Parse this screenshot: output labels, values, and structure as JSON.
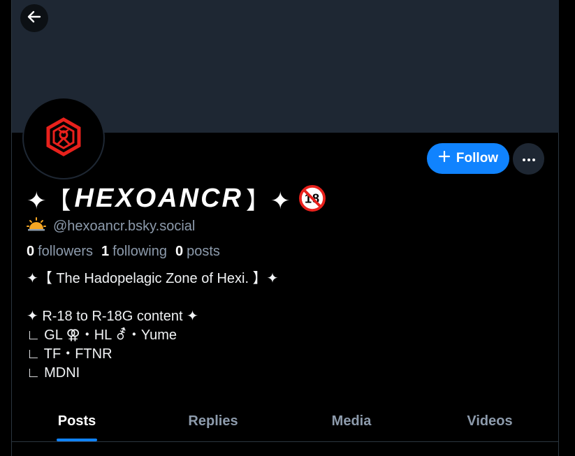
{
  "profile": {
    "display_name_prefix": "✦【",
    "display_name_core": "HEXOANCR",
    "display_name_suffix": "】✦",
    "adult_badge": "18",
    "handle": "@hexoancr.bsky.social",
    "handle_emoji": "🌥"
  },
  "actions": {
    "follow_label": "Follow",
    "back_icon": "arrow-left-icon",
    "more_icon": "ellipsis-icon"
  },
  "stats": {
    "followers_count": "0",
    "followers_label": "followers",
    "following_count": "1",
    "following_label": "following",
    "posts_count": "0",
    "posts_label": "posts"
  },
  "bio": {
    "lines": [
      "✦【 The Hadopelagic Zone of Hexi. 】✦",
      "",
      "✦ R-18 to R-18G content ✦",
      "∟ GL ⚢・HL ⚦・Yume",
      "∟ TF・FTNR",
      "∟ MDNI"
    ]
  },
  "tabs": [
    {
      "label": "Posts",
      "active": true
    },
    {
      "label": "Replies",
      "active": false
    },
    {
      "label": "Media",
      "active": false
    },
    {
      "label": "Videos",
      "active": false
    }
  ],
  "colors": {
    "accent": "#1083fe",
    "banner": "#1e2733",
    "muted_text": "#8d9bac",
    "avatar_logo": "#e8211c"
  }
}
